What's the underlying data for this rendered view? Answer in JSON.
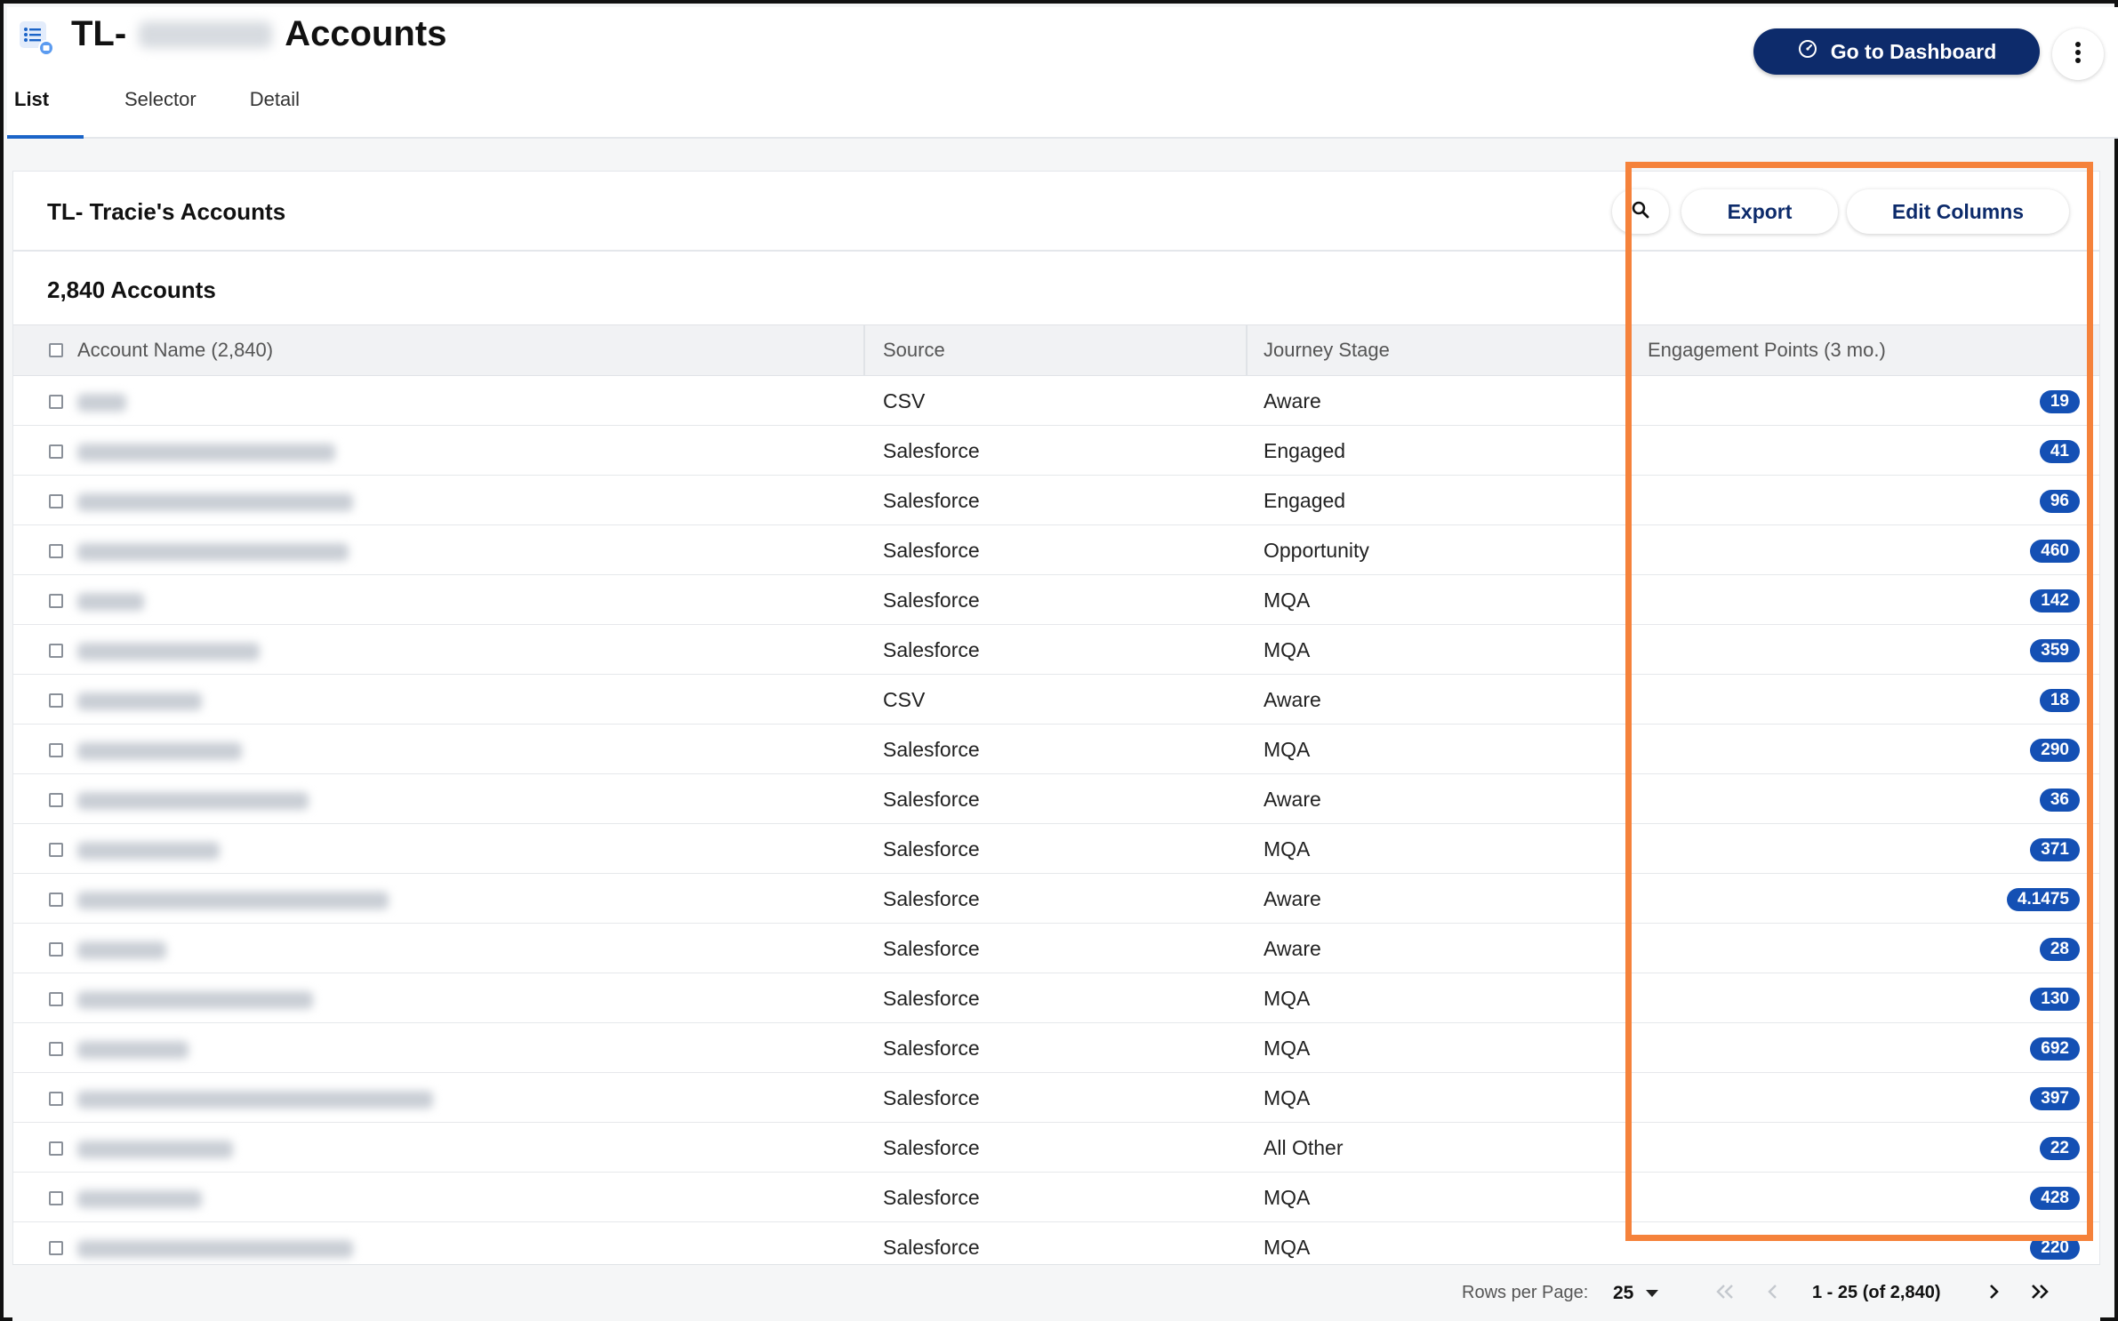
{
  "header": {
    "title_prefix": "TL-",
    "title_suffix": "Accounts",
    "tabs": [
      {
        "label": "List",
        "active": true
      },
      {
        "label": "Selector",
        "active": false
      },
      {
        "label": "Detail",
        "active": false
      }
    ],
    "dashboard_button": "Go to Dashboard"
  },
  "card": {
    "title": "TL- Tracie's Accounts",
    "export_label": "Export",
    "edit_columns_label": "Edit Columns",
    "count_label": "2,840 Accounts"
  },
  "table": {
    "columns": {
      "account_name": "Account Name (2,840)",
      "source": "Source",
      "journey_stage": "Journey Stage",
      "engagement": "Engagement Points (3 mo.)"
    },
    "rows": [
      {
        "source": "CSV",
        "stage": "Aware",
        "points": "19"
      },
      {
        "source": "Salesforce",
        "stage": "Engaged",
        "points": "41"
      },
      {
        "source": "Salesforce",
        "stage": "Engaged",
        "points": "96"
      },
      {
        "source": "Salesforce",
        "stage": "Opportunity",
        "points": "460"
      },
      {
        "source": "Salesforce",
        "stage": "MQA",
        "points": "142"
      },
      {
        "source": "Salesforce",
        "stage": "MQA",
        "points": "359"
      },
      {
        "source": "CSV",
        "stage": "Aware",
        "points": "18"
      },
      {
        "source": "Salesforce",
        "stage": "MQA",
        "points": "290"
      },
      {
        "source": "Salesforce",
        "stage": "Aware",
        "points": "36"
      },
      {
        "source": "Salesforce",
        "stage": "MQA",
        "points": "371"
      },
      {
        "source": "Salesforce",
        "stage": "Aware",
        "points": "4.1475"
      },
      {
        "source": "Salesforce",
        "stage": "Aware",
        "points": "28"
      },
      {
        "source": "Salesforce",
        "stage": "MQA",
        "points": "130"
      },
      {
        "source": "Salesforce",
        "stage": "MQA",
        "points": "692"
      },
      {
        "source": "Salesforce",
        "stage": "MQA",
        "points": "397"
      },
      {
        "source": "Salesforce",
        "stage": "All Other",
        "points": "22"
      },
      {
        "source": "Salesforce",
        "stage": "MQA",
        "points": "428"
      },
      {
        "source": "Salesforce",
        "stage": "MQA",
        "points": "220"
      }
    ]
  },
  "pagination": {
    "rows_per_page_label": "Rows per Page:",
    "rows_per_page_value": "25",
    "range_label": "1 - 25 (of 2,840)"
  },
  "colors": {
    "primary": "#0d2b6b",
    "badge": "#1450b4",
    "highlight": "#f5823b"
  }
}
